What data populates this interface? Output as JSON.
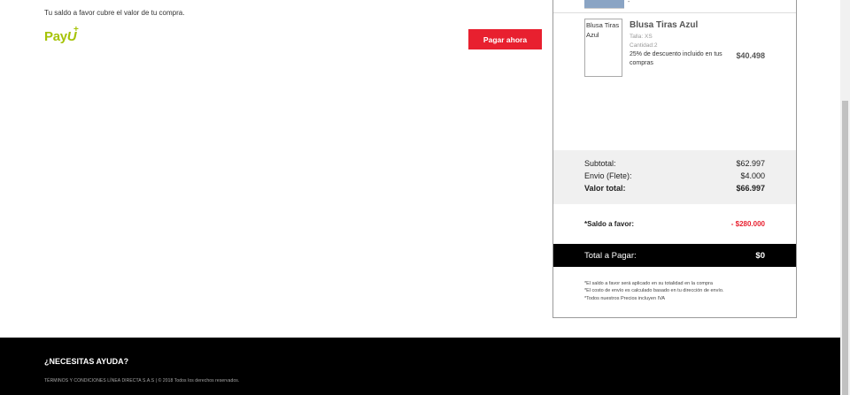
{
  "checkout": {
    "balance_message": "Tu saldo a favor cubre el valor de tu compra.",
    "payment_provider": "PayU",
    "pay_button_label": "Pagar ahora"
  },
  "order": {
    "item": {
      "image_alt": "Blusa Tiras Azul",
      "name": "Blusa Tiras Azul",
      "size": "Talla: XS",
      "quantity": "Cantidad:2",
      "discount_note": "25% de descuento incluido en tus compras",
      "price": "$40.498"
    },
    "summary": {
      "subtotal_label": "Subtotal:",
      "subtotal_value": "$62.997",
      "shipping_label": "Envio (Flete):",
      "shipping_value": "$4.000",
      "total_value_label": "Valor total:",
      "total_value": "$66.997",
      "balance_label": "*Saldo a favor:",
      "balance_value": "- $280.000",
      "to_pay_label": "Total a Pagar:",
      "to_pay_value": "$0"
    },
    "notes": [
      "*El saldo a favor será aplicado en su totalidad en la compra",
      "*El costo de envío es calculado basado en tu dirección de envío.",
      "*Todos nuestros Precios incluyen IVA"
    ]
  },
  "footer": {
    "help_title": "¿NECESITAS AYUDA?",
    "legal": "TÉRMINOS Y CONDICIONES LÍNEA DIRECTA S.A.S  |  © 2018 Todos los derechos reservados."
  },
  "colors": {
    "accent_red": "#e8202f",
    "payu_green": "#a6c307",
    "footer_bg": "#000000"
  }
}
